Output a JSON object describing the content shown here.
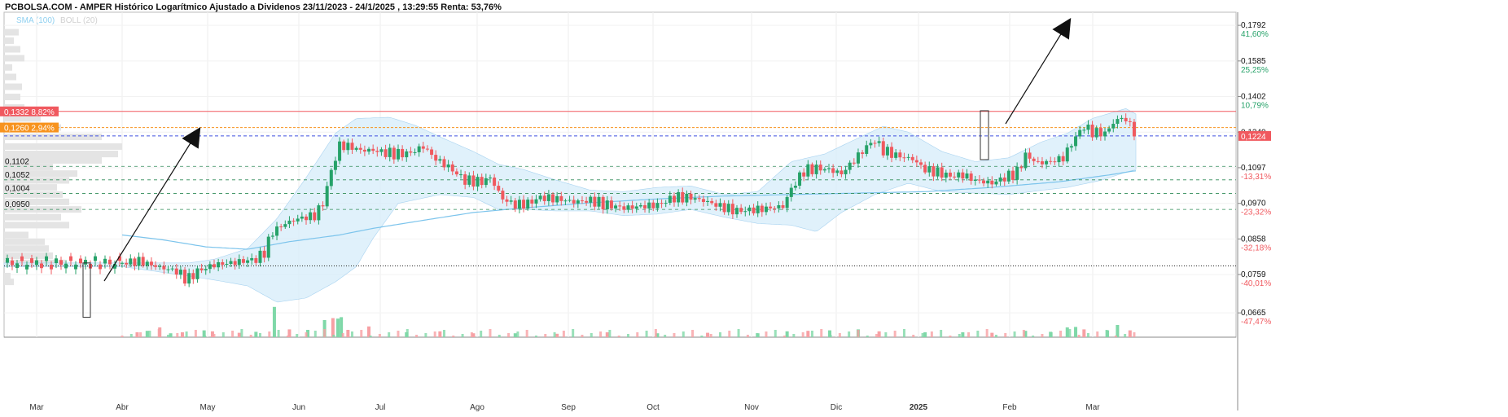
{
  "header": {
    "title": "PCBOLSA.COM - AMPER Histórico Logarítmico Ajustado a Dividenos 23/11/2023 - 24/1/2025 , 13:29:55 Renta: 53,76%",
    "sma_label": "SMA (100)",
    "boll_label": "BOLL (20)"
  },
  "colors": {
    "up": "#26a269",
    "down": "#f0595f",
    "bollinger_fill": "#d6ecfa",
    "sma_line": "#7cc4ec",
    "resistance_red": "#f0595f",
    "resistance_orange": "#f7931e",
    "current_price": "#4050e0",
    "support_green": "#2e8b57",
    "volume_up": "#7fd8a8",
    "volume_down": "#f7a0a4"
  },
  "chart_data": {
    "type": "candlestick",
    "y_scale": "log",
    "ylim": [
      0.0615,
      0.1875
    ],
    "x_labels": [
      "Mar",
      "Abr",
      "May",
      "Jun",
      "Jul",
      "Ago",
      "Sep",
      "Oct",
      "Nov",
      "Dic",
      "2025",
      "Feb",
      "Mar"
    ],
    "right_axis": [
      {
        "price": "0,1792",
        "pct": "41,60%",
        "sign": "up"
      },
      {
        "price": "0,1585",
        "pct": "25,25%",
        "sign": "up"
      },
      {
        "price": "0,1402",
        "pct": "10,79%",
        "sign": "up"
      },
      {
        "price": "0,1240",
        "pct": "",
        "sign": "none"
      },
      {
        "price": "0,1097",
        "pct": "-13,31%",
        "sign": "down"
      },
      {
        "price": "0,0970",
        "pct": "-23,32%",
        "sign": "down"
      },
      {
        "price": "0,0858",
        "pct": "-32,18%",
        "sign": "down"
      },
      {
        "price": "0,0759",
        "pct": "-40,01%",
        "sign": "down"
      },
      {
        "price": "0,0665",
        "pct": "-47,47%",
        "sign": "down"
      }
    ],
    "current_price": {
      "value": 0.1224,
      "label": "0,1224"
    },
    "resistance_lines": [
      {
        "value": 0.1332,
        "label": "0,1332 8,82%",
        "color": "red"
      },
      {
        "value": 0.126,
        "label": "0,1260 2,94%",
        "color": "orange"
      }
    ],
    "support_lines": [
      {
        "value": 0.1102,
        "label": "0,1102"
      },
      {
        "value": 0.1052,
        "label": "0,1052"
      },
      {
        "value": 0.1004,
        "label": "0,1004"
      },
      {
        "value": 0.095,
        "label": "0,0950"
      }
    ],
    "reference_line": {
      "value": 0.0782
    },
    "price_waypoints": [
      [
        0,
        0.079
      ],
      [
        20,
        0.0795
      ],
      [
        45,
        0.0778
      ],
      [
        65,
        0.0768
      ],
      [
        78,
        0.0745
      ],
      [
        90,
        0.0768
      ],
      [
        110,
        0.0785
      ],
      [
        130,
        0.079
      ],
      [
        160,
        0.08
      ],
      [
        170,
        0.082
      ],
      [
        180,
        0.088
      ],
      [
        195,
        0.0905
      ],
      [
        210,
        0.092
      ],
      [
        230,
        0.093
      ],
      [
        240,
        0.097
      ],
      [
        250,
        0.1085
      ],
      [
        260,
        0.1185
      ],
      [
        272,
        0.118
      ],
      [
        285,
        0.1165
      ],
      [
        300,
        0.1165
      ],
      [
        315,
        0.1155
      ],
      [
        330,
        0.115
      ],
      [
        345,
        0.1155
      ],
      [
        360,
        0.118
      ],
      [
        375,
        0.113
      ],
      [
        390,
        0.11
      ],
      [
        410,
        0.105
      ],
      [
        430,
        0.1045
      ],
      [
        440,
        0.106
      ],
      [
        455,
        0.0985
      ],
      [
        470,
        0.0965
      ],
      [
        485,
        0.097
      ],
      [
        500,
        0.099
      ],
      [
        520,
        0.0985
      ],
      [
        540,
        0.0975
      ],
      [
        560,
        0.098
      ],
      [
        580,
        0.0965
      ],
      [
        600,
        0.0955
      ],
      [
        620,
        0.096
      ],
      [
        640,
        0.0965
      ],
      [
        660,
        0.099
      ],
      [
        680,
        0.099
      ],
      [
        700,
        0.0975
      ],
      [
        715,
        0.096
      ],
      [
        735,
        0.0945
      ],
      [
        760,
        0.095
      ],
      [
        790,
        0.096
      ],
      [
        800,
        0.102
      ],
      [
        815,
        0.1085
      ],
      [
        830,
        0.1095
      ],
      [
        845,
        0.109
      ],
      [
        860,
        0.1075
      ],
      [
        875,
        0.1125
      ],
      [
        890,
        0.118
      ],
      [
        900,
        0.1205
      ],
      [
        910,
        0.1165
      ],
      [
        925,
        0.1145
      ],
      [
        945,
        0.113
      ],
      [
        960,
        0.109
      ],
      [
        975,
        0.108
      ],
      [
        990,
        0.1065
      ],
      [
        1005,
        0.107
      ],
      [
        1020,
        0.105
      ],
      [
        1040,
        0.104
      ],
      [
        1055,
        0.106
      ],
      [
        1070,
        0.108
      ],
      [
        1080,
        0.1145
      ],
      [
        1095,
        0.1115
      ],
      [
        1110,
        0.112
      ],
      [
        1125,
        0.1135
      ],
      [
        1140,
        0.122
      ],
      [
        1150,
        0.1265
      ],
      [
        1160,
        0.124
      ],
      [
        1175,
        0.1235
      ],
      [
        1185,
        0.128
      ],
      [
        1195,
        0.1305
      ],
      [
        1205,
        0.1275
      ],
      [
        1212,
        0.1224
      ]
    ],
    "sma_waypoints": [
      [
        0,
        0.087
      ],
      [
        50,
        0.0855
      ],
      [
        100,
        0.0835
      ],
      [
        150,
        0.0828
      ],
      [
        200,
        0.085
      ],
      [
        260,
        0.087
      ],
      [
        300,
        0.089
      ],
      [
        360,
        0.0915
      ],
      [
        420,
        0.094
      ],
      [
        480,
        0.0955
      ],
      [
        560,
        0.0972
      ],
      [
        640,
        0.0985
      ],
      [
        720,
        0.0995
      ],
      [
        800,
        0.1
      ],
      [
        880,
        0.1005
      ],
      [
        960,
        0.101
      ],
      [
        1040,
        0.1025
      ],
      [
        1120,
        0.1045
      ],
      [
        1180,
        0.107
      ],
      [
        1210,
        0.1085
      ]
    ],
    "bollinger_bands": {
      "upper": [
        [
          0,
          0.079
        ],
        [
          80,
          0.079
        ],
        [
          110,
          0.08
        ],
        [
          150,
          0.083
        ],
        [
          185,
          0.092
        ],
        [
          220,
          0.106
        ],
        [
          255,
          0.1235
        ],
        [
          280,
          0.13
        ],
        [
          320,
          0.1305
        ],
        [
          350,
          0.127
        ],
        [
          380,
          0.122
        ],
        [
          420,
          0.116
        ],
        [
          450,
          0.111
        ],
        [
          480,
          0.109
        ],
        [
          520,
          0.105
        ],
        [
          560,
          0.1015
        ],
        [
          600,
          0.101
        ],
        [
          640,
          0.1025
        ],
        [
          680,
          0.103
        ],
        [
          720,
          0.1
        ],
        [
          760,
          0.101
        ],
        [
          800,
          0.112
        ],
        [
          840,
          0.115
        ],
        [
          880,
          0.1215
        ],
        [
          910,
          0.1265
        ],
        [
          940,
          0.124
        ],
        [
          980,
          0.116
        ],
        [
          1020,
          0.112
        ],
        [
          1060,
          0.1135
        ],
        [
          1100,
          0.12
        ],
        [
          1130,
          0.1235
        ],
        [
          1160,
          0.13
        ],
        [
          1200,
          0.1345
        ],
        [
          1212,
          0.132
        ]
      ],
      "lower": [
        [
          0,
          0.078
        ],
        [
          80,
          0.0755
        ],
        [
          110,
          0.0745
        ],
        [
          150,
          0.073
        ],
        [
          185,
          0.069
        ],
        [
          220,
          0.07
        ],
        [
          255,
          0.074
        ],
        [
          280,
          0.078
        ],
        [
          300,
          0.086
        ],
        [
          330,
          0.097
        ],
        [
          380,
          0.1
        ],
        [
          420,
          0.099
        ],
        [
          450,
          0.095
        ],
        [
          480,
          0.095
        ],
        [
          520,
          0.0945
        ],
        [
          560,
          0.0945
        ],
        [
          600,
          0.093
        ],
        [
          640,
          0.0935
        ],
        [
          680,
          0.095
        ],
        [
          720,
          0.0925
        ],
        [
          760,
          0.0905
        ],
        [
          800,
          0.09
        ],
        [
          830,
          0.088
        ],
        [
          860,
          0.094
        ],
        [
          900,
          0.1
        ],
        [
          940,
          0.104
        ],
        [
          980,
          0.101
        ],
        [
          1020,
          0.1005
        ],
        [
          1060,
          0.1
        ],
        [
          1100,
          0.1015
        ],
        [
          1130,
          0.1025
        ],
        [
          1170,
          0.105
        ],
        [
          1200,
          0.108
        ],
        [
          1212,
          0.109
        ]
      ]
    },
    "volume_bars": [
      [
        18,
        1.0,
        "down"
      ],
      [
        30,
        1.3,
        "up"
      ],
      [
        45,
        2.0,
        "down"
      ],
      [
        58,
        0.8,
        "up"
      ],
      [
        72,
        1.0,
        "down"
      ],
      [
        98,
        1.4,
        "up"
      ],
      [
        108,
        1.2,
        "down"
      ],
      [
        140,
        0.9,
        "down"
      ],
      [
        160,
        1.1,
        "up"
      ],
      [
        182,
        6.2,
        "up"
      ],
      [
        200,
        1.6,
        "down"
      ],
      [
        222,
        1.5,
        "up"
      ],
      [
        242,
        3.5,
        "up"
      ],
      [
        252,
        3.9,
        "down"
      ],
      [
        258,
        3.8,
        "up"
      ],
      [
        262,
        4.1,
        "up"
      ],
      [
        270,
        1.5,
        "down"
      ],
      [
        295,
        2.2,
        "down"
      ],
      [
        340,
        1.0,
        "up"
      ],
      [
        380,
        1.2,
        "down"
      ],
      [
        420,
        0.8,
        "down"
      ],
      [
        470,
        0.8,
        "up"
      ],
      [
        520,
        0.7,
        "down"
      ],
      [
        580,
        1.0,
        "down"
      ],
      [
        640,
        0.8,
        "up"
      ],
      [
        700,
        0.9,
        "down"
      ],
      [
        760,
        0.8,
        "up"
      ],
      [
        795,
        1.2,
        "up"
      ],
      [
        820,
        1.3,
        "down"
      ],
      [
        846,
        1.4,
        "up"
      ],
      [
        880,
        1.6,
        "up"
      ],
      [
        905,
        1.2,
        "down"
      ],
      [
        960,
        1.0,
        "up"
      ],
      [
        1005,
        1.0,
        "up"
      ],
      [
        1040,
        0.9,
        "down"
      ],
      [
        1080,
        1.3,
        "up"
      ],
      [
        1110,
        1.1,
        "up"
      ],
      [
        1130,
        2.0,
        "up"
      ],
      [
        1140,
        2.1,
        "up"
      ],
      [
        1150,
        1.6,
        "down"
      ],
      [
        1178,
        1.4,
        "up"
      ],
      [
        1190,
        2.5,
        "up"
      ],
      [
        1205,
        1.4,
        "down"
      ]
    ],
    "volume_profile": [
      [
        0.074,
        12
      ],
      [
        0.0755,
        8
      ],
      [
        0.079,
        75
      ],
      [
        0.081,
        60
      ],
      [
        0.083,
        55
      ],
      [
        0.085,
        50
      ],
      [
        0.087,
        30
      ],
      [
        0.09,
        80
      ],
      [
        0.0925,
        70
      ],
      [
        0.095,
        95
      ],
      [
        0.0975,
        80
      ],
      [
        0.1,
        72
      ],
      [
        0.1025,
        65
      ],
      [
        0.105,
        80
      ],
      [
        0.1075,
        90
      ],
      [
        0.11,
        60
      ],
      [
        0.1125,
        120
      ],
      [
        0.115,
        140
      ],
      [
        0.118,
        145
      ],
      [
        0.122,
        120
      ],
      [
        0.126,
        70
      ],
      [
        0.13,
        45
      ],
      [
        0.135,
        25
      ],
      [
        0.14,
        20
      ],
      [
        0.145,
        22
      ],
      [
        0.15,
        15
      ],
      [
        0.155,
        10
      ],
      [
        0.16,
        25
      ],
      [
        0.165,
        20
      ],
      [
        0.17,
        12
      ],
      [
        0.175,
        18
      ]
    ]
  }
}
